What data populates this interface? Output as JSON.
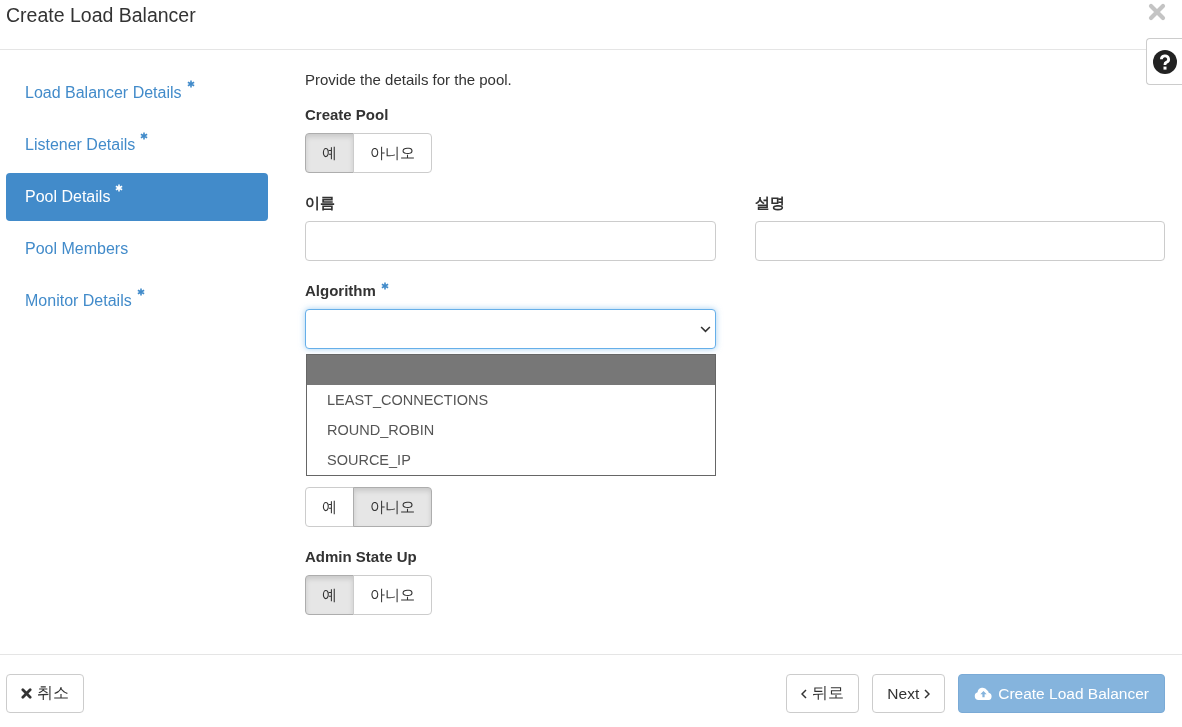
{
  "window": {
    "title": "Create Load Balancer"
  },
  "sidebar": {
    "items": [
      {
        "label": "Load Balancer Details",
        "required": true,
        "selected": false
      },
      {
        "label": "Listener Details",
        "required": true,
        "selected": false
      },
      {
        "label": "Pool Details",
        "required": true,
        "selected": true
      },
      {
        "label": "Pool Members",
        "required": false,
        "selected": false
      },
      {
        "label": "Monitor Details",
        "required": true,
        "selected": false
      }
    ]
  },
  "form": {
    "intro": "Provide the details for the pool.",
    "fields": [
      {
        "kind": "toggle",
        "label": "Create Pool",
        "options": [
          {
            "label": "예",
            "selected": true
          },
          {
            "label": "아니오",
            "selected": false
          }
        ]
      },
      {
        "kind": "text_pair",
        "inputs": [
          {
            "label": "이름"
          },
          {
            "label": "설명"
          }
        ]
      },
      {
        "kind": "select",
        "label": "Algorithm",
        "required": true,
        "open": true,
        "options": [
          {
            "kind": "blank",
            "selected": true
          },
          {
            "kind": "option",
            "label": "LEAST_CONNECTIONS",
            "selected": false
          },
          {
            "kind": "option",
            "label": "ROUND_ROBIN",
            "selected": false
          },
          {
            "kind": "option",
            "label": "SOURCE_IP",
            "selected": false
          }
        ]
      },
      {
        "kind": "toggle",
        "options": [
          {
            "label": "예",
            "selected": false
          },
          {
            "label": "아니오",
            "selected": true
          }
        ]
      },
      {
        "kind": "toggle",
        "label": "Admin State Up",
        "options": [
          {
            "label": "예",
            "selected": true
          },
          {
            "label": "아니오",
            "selected": false
          }
        ]
      }
    ]
  },
  "footer": {
    "buttons": [
      {
        "kind": "cancel",
        "label": "취소",
        "disabled": false
      },
      {
        "kind": "back",
        "label": "뒤로",
        "disabled": false
      },
      {
        "kind": "next",
        "label": "Next",
        "disabled": false
      },
      {
        "kind": "submit",
        "label": "Create Load Balancer",
        "disabled": true
      }
    ]
  }
}
